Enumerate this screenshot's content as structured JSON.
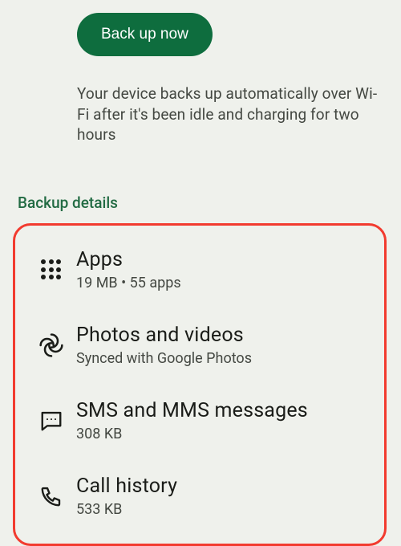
{
  "button_label": "Back up now",
  "info_text": "Your device backs up automatically over Wi-Fi after it's been idle and charging for two hours",
  "section_title": "Backup details",
  "items": {
    "0": {
      "title": "Apps",
      "sub": "19 MB • 55 apps"
    },
    "1": {
      "title": "Photos and videos",
      "sub": "Synced with Google Photos"
    },
    "2": {
      "title": "SMS and MMS messages",
      "sub": "308 KB"
    },
    "3": {
      "title": "Call history",
      "sub": "533 KB"
    }
  }
}
